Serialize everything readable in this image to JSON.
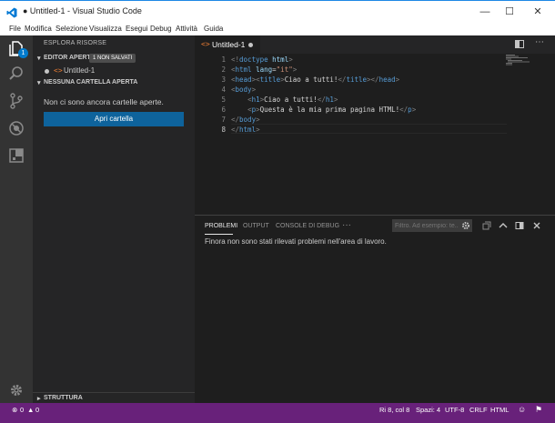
{
  "window": {
    "title": "● Untitled-1 - Visual Studio Code"
  },
  "menu": [
    "File",
    "Modifica",
    "Selezione",
    "Visualizza",
    "Esegui",
    "Debug",
    "Attività",
    "Guida"
  ],
  "activity": {
    "badge_count": "1"
  },
  "sidebar": {
    "title": "ESPLORA RISORSE",
    "open_editors": {
      "label": "EDITOR APERTI",
      "badge": "1 NON SALVATI",
      "file": "Untitled-1",
      "file_icon": "<>"
    },
    "no_folder": {
      "label": "NESSUNA CARTELLA APERTA",
      "message": "Non ci sono ancora cartelle aperte.",
      "button": "Apri cartella"
    },
    "structure": {
      "label": "STRUTTURA"
    }
  },
  "tab": {
    "name": "Untitled-1",
    "icon": "<>"
  },
  "editor": {
    "lines": [
      {
        "n": "1",
        "tokens": [
          [
            "t-punc",
            "<!"
          ],
          [
            "t-tag",
            "doctype"
          ],
          [
            "t-txt",
            " "
          ],
          [
            "t-attr",
            "html"
          ],
          [
            "t-punc",
            ">"
          ]
        ]
      },
      {
        "n": "2",
        "tokens": [
          [
            "t-punc",
            "<"
          ],
          [
            "t-tag",
            "html"
          ],
          [
            "t-txt",
            " "
          ],
          [
            "t-attr",
            "lang"
          ],
          [
            "t-txt",
            "="
          ],
          [
            "t-str",
            "\"it\""
          ],
          [
            "t-punc",
            ">"
          ]
        ]
      },
      {
        "n": "3",
        "tokens": [
          [
            "t-punc",
            "<"
          ],
          [
            "t-tag",
            "head"
          ],
          [
            "t-punc",
            "><"
          ],
          [
            "t-tag",
            "title"
          ],
          [
            "t-punc",
            ">"
          ],
          [
            "t-txt",
            "Ciao a tutti!"
          ],
          [
            "t-punc",
            "</"
          ],
          [
            "t-tag",
            "title"
          ],
          [
            "t-punc",
            "></"
          ],
          [
            "t-tag",
            "head"
          ],
          [
            "t-punc",
            ">"
          ]
        ]
      },
      {
        "n": "4",
        "tokens": [
          [
            "t-punc",
            "<"
          ],
          [
            "t-tag",
            "body"
          ],
          [
            "t-punc",
            ">"
          ]
        ]
      },
      {
        "n": "5",
        "tokens": [
          [
            "t-txt",
            "    "
          ],
          [
            "t-punc",
            "<"
          ],
          [
            "t-tag",
            "h1"
          ],
          [
            "t-punc",
            ">"
          ],
          [
            "t-txt",
            "Ciao a tutti!"
          ],
          [
            "t-punc",
            "</"
          ],
          [
            "t-tag",
            "h1"
          ],
          [
            "t-punc",
            ">"
          ]
        ]
      },
      {
        "n": "6",
        "tokens": [
          [
            "t-txt",
            "    "
          ],
          [
            "t-punc",
            "<"
          ],
          [
            "t-tag",
            "p"
          ],
          [
            "t-punc",
            ">"
          ],
          [
            "t-txt",
            "Questa è la mia prima pagina HTML!"
          ],
          [
            "t-punc",
            "</"
          ],
          [
            "t-tag",
            "p"
          ],
          [
            "t-punc",
            ">"
          ]
        ]
      },
      {
        "n": "7",
        "tokens": [
          [
            "t-punc",
            "</"
          ],
          [
            "t-tag",
            "body"
          ],
          [
            "t-punc",
            ">"
          ]
        ]
      },
      {
        "n": "8",
        "tokens": [
          [
            "t-punc",
            "</"
          ],
          [
            "t-tag",
            "html"
          ],
          [
            "t-punc",
            ">"
          ]
        ]
      }
    ]
  },
  "panel": {
    "tabs": [
      "PROBLEMI",
      "OUTPUT",
      "CONSOLE DI DEBUG"
    ],
    "more": "···",
    "filter_placeholder": "Filtro. Ad esempio: te...",
    "message": "Finora non sono stati rilevati problemi nell'area di lavoro."
  },
  "status": {
    "errors": "0",
    "warnings": "0",
    "position": "Ri 8, col 8",
    "spaces": "Spazi: 4",
    "encoding": "UTF-8",
    "eol": "CRLF",
    "language": "HTML"
  },
  "colors": {
    "accent": "#007acc",
    "statusbar": "#68217a",
    "button": "#0e639c"
  }
}
